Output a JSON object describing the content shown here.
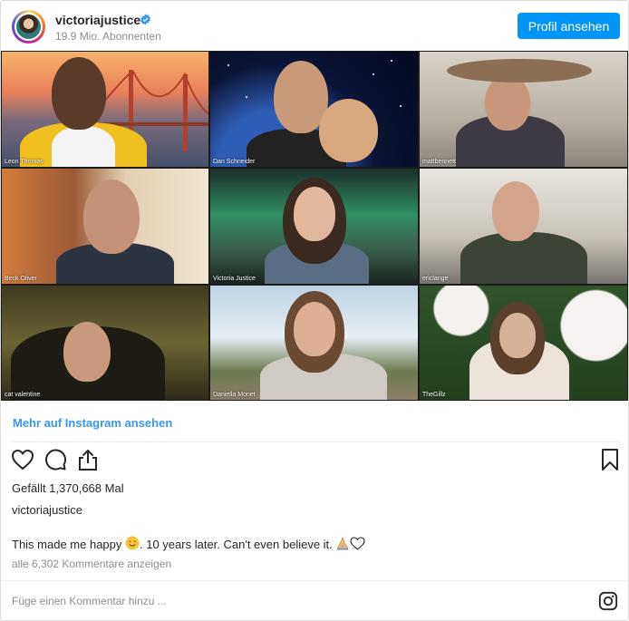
{
  "header": {
    "username": "victoriajustice",
    "followers": "19.9 Mio. Abonnenten",
    "profile_button": "Profil ansehen"
  },
  "grid": {
    "tiles": [
      {
        "label": "Leon Thomas"
      },
      {
        "label": "Dan Schneider"
      },
      {
        "label": "mattbennett"
      },
      {
        "label": "Beck Oliver"
      },
      {
        "label": "Victoria Justice"
      },
      {
        "label": "ericlange"
      },
      {
        "label": "cat valentine"
      },
      {
        "label": "Daniella Monet"
      },
      {
        "label": "TheGillz"
      }
    ]
  },
  "post": {
    "more_link": "Mehr auf Instagram ansehen",
    "likes": "Gefällt 1,370,668 Mal",
    "caption_user": "victoriajustice",
    "caption_part1": "This made me happy ",
    "caption_part2": ". 10 years later. Can't even believe it. ",
    "comments_link": "alle 6,302 Kommentare anzeigen",
    "comment_placeholder": "Füge einen Kommentar hinzu ..."
  },
  "icons": {
    "verified": "verified-badge-icon",
    "like": "heart-icon",
    "comment": "comment-icon",
    "share": "share-icon",
    "save": "bookmark-icon",
    "logo": "instagram-logo-icon"
  },
  "colors": {
    "accent": "#0095f6",
    "link": "#3897f0",
    "muted": "#8e8e8e"
  }
}
